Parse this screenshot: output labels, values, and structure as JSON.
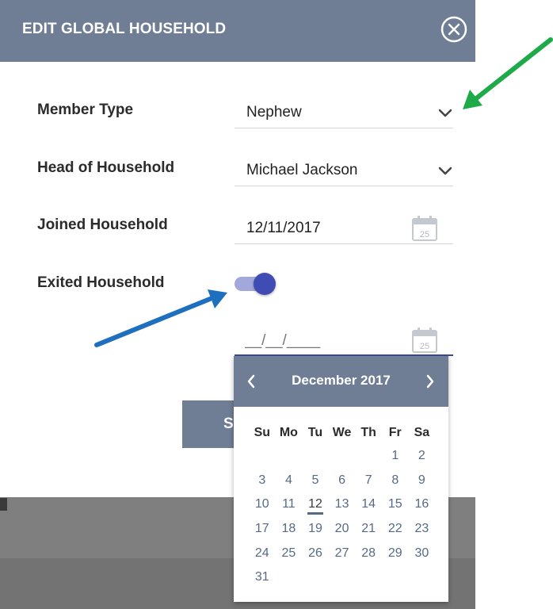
{
  "dialog": {
    "title": "EDIT GLOBAL HOUSEHOLD"
  },
  "form": {
    "member_type": {
      "label": "Member Type",
      "value": "Nephew"
    },
    "head_of_household": {
      "label": "Head of Household",
      "value": "Michael Jackson"
    },
    "joined_household": {
      "label": "Joined Household",
      "value": "12/11/2017",
      "calendar_day": "25"
    },
    "exited_household": {
      "label": "Exited Household",
      "toggle_on": true,
      "placeholder": "__/__/____",
      "calendar_day": "25"
    }
  },
  "save_button": {
    "label": "S"
  },
  "datepicker": {
    "title": "December 2017",
    "prev_glyph": "‹",
    "next_glyph": "›",
    "weekdays": [
      "Su",
      "Mo",
      "Tu",
      "We",
      "Th",
      "Fr",
      "Sa"
    ],
    "weeks": [
      [
        "",
        "",
        "",
        "",
        "",
        "1",
        "2"
      ],
      [
        "3",
        "4",
        "5",
        "6",
        "7",
        "8",
        "9"
      ],
      [
        "10",
        "11",
        "12",
        "13",
        "14",
        "15",
        "16"
      ],
      [
        "17",
        "18",
        "19",
        "20",
        "21",
        "22",
        "23"
      ],
      [
        "24",
        "25",
        "26",
        "27",
        "28",
        "29",
        "30"
      ],
      [
        "31",
        "",
        "",
        "",
        "",
        "",
        ""
      ]
    ],
    "today": "12"
  },
  "colors": {
    "header": "#6f7d95",
    "accent": "#3f4cb3",
    "day_text": "#566a86",
    "arrow_green": "#1faa4a",
    "arrow_blue": "#1f6fbf"
  },
  "icons": {
    "close": "close-circle-icon",
    "dropdown": "chevron-down-icon",
    "calendar": "calendar-icon",
    "prev": "chevron-left-icon",
    "next": "chevron-right-icon"
  }
}
